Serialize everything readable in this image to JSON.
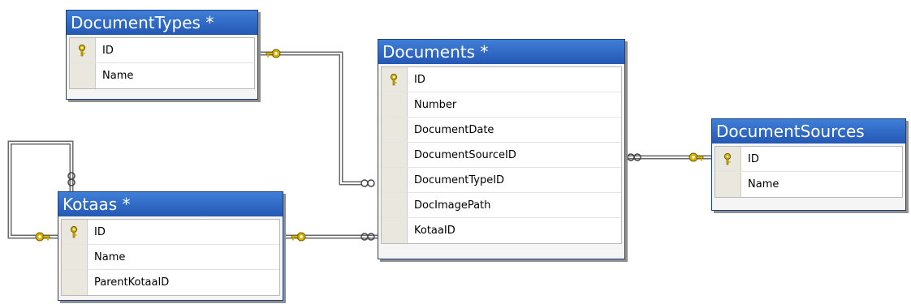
{
  "tables": {
    "documenttypes": {
      "title": "DocumentTypes *",
      "rows": [
        {
          "label": "ID",
          "is_key": true
        },
        {
          "label": "Name",
          "is_key": false
        }
      ]
    },
    "documents": {
      "title": "Documents *",
      "rows": [
        {
          "label": "ID",
          "is_key": true
        },
        {
          "label": "Number",
          "is_key": false
        },
        {
          "label": "DocumentDate",
          "is_key": false
        },
        {
          "label": "DocumentSourceID",
          "is_key": false
        },
        {
          "label": "DocumentTypeID",
          "is_key": false
        },
        {
          "label": "DocImagePath",
          "is_key": false
        },
        {
          "label": "KotaaID",
          "is_key": false
        }
      ]
    },
    "documentsources": {
      "title": "DocumentSources",
      "rows": [
        {
          "label": "ID",
          "is_key": true
        },
        {
          "label": "Name",
          "is_key": false
        }
      ]
    },
    "kotaas": {
      "title": "Kotaas *",
      "rows": [
        {
          "label": "ID",
          "is_key": true
        },
        {
          "label": "Name",
          "is_key": false
        },
        {
          "label": "ParentKotaaID",
          "is_key": false
        }
      ]
    }
  },
  "relationships": [
    {
      "from": "documenttypes",
      "to": "documents",
      "one_end": "key",
      "many_end": "infinity"
    },
    {
      "from": "documentsources",
      "to": "documents",
      "one_end": "key",
      "many_end": "infinity"
    },
    {
      "from": "kotaas",
      "to": "documents",
      "one_end": "key",
      "many_end": "infinity"
    },
    {
      "from": "kotaas",
      "to": "kotaas",
      "one_end": "key",
      "many_end": "infinity"
    }
  ],
  "colors": {
    "title_bar": "#2f6bc8",
    "key_icon": "#d8b400",
    "line": "#6a6a6a"
  }
}
